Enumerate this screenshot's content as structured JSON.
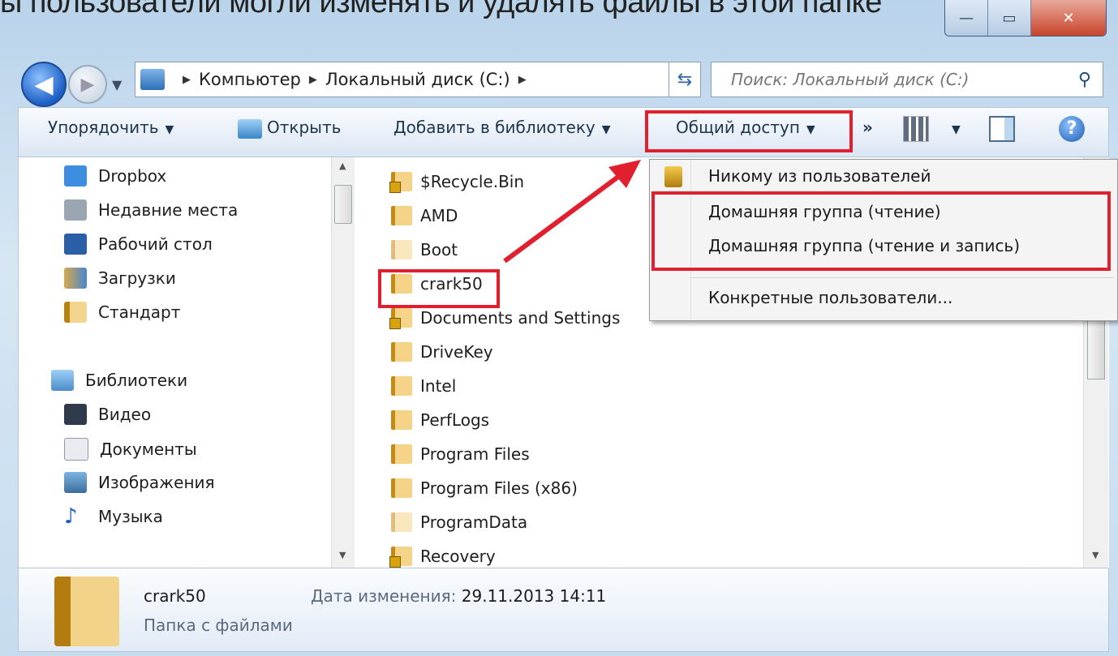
{
  "caption": "ы пользователи могли изменять и удалять файлы в этой папке",
  "window": {
    "minimize_icon": "minimize-icon",
    "maximize_icon": "maximize-icon",
    "close_icon": "close-icon"
  },
  "address": {
    "crumbs": [
      "Компьютер",
      "Локальный диск (C:)"
    ],
    "search_placeholder": "Поиск: Локальный диск (C:)"
  },
  "toolbar": {
    "organize": "Упорядочить",
    "open": "Открыть",
    "add_library": "Добавить в библиотеку",
    "share": "Общий доступ",
    "more": "»"
  },
  "nav": {
    "favorites": [
      "Dropbox",
      "Недавние места",
      "Рабочий стол",
      "Загрузки",
      "Стандарт"
    ],
    "libraries_title": "Библиотеки",
    "libraries": [
      "Видео",
      "Документы",
      "Изображения",
      "Музыка"
    ]
  },
  "files": [
    "$Recycle.Bin",
    "AMD",
    "Boot",
    "crark50",
    "Documents and Settings",
    "DriveKey",
    "Intel",
    "PerfLogs",
    "Program Files",
    "Program Files (x86)",
    "ProgramData",
    "Recovery"
  ],
  "share_menu": {
    "items": [
      "Никому из пользователей",
      "Домашняя группа (чтение)",
      "Домашняя группа (чтение и запись)",
      "Конкретные пользователи..."
    ]
  },
  "details": {
    "name": "crark50",
    "modified_label": "Дата изменения:",
    "modified_value": "29.11.2013 14:11",
    "type": "Папка с файлами"
  },
  "colors": {
    "accent_red": "#e0202e",
    "toolbar_text": "#1e3550"
  }
}
